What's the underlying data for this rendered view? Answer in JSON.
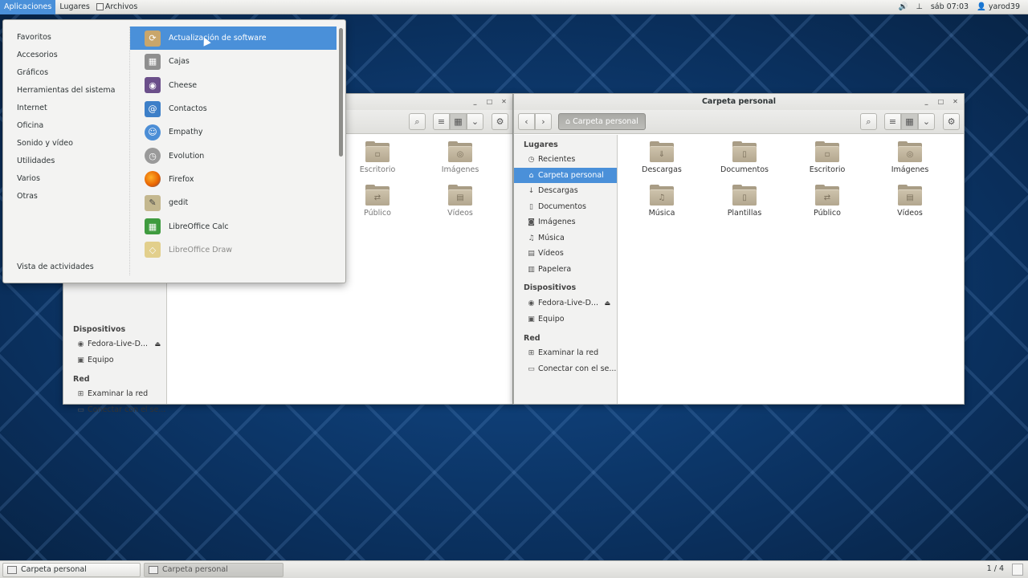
{
  "topbar": {
    "menus": [
      "Aplicaciones",
      "Lugares",
      "Archivos"
    ],
    "clock": "sáb 07:03",
    "user": "yarod39"
  },
  "appmenu": {
    "categories": [
      "Favoritos",
      "Accesorios",
      "Gráficos",
      "Herramientas del sistema",
      "Internet",
      "Oficina",
      "Sonido y vídeo",
      "Utilidades",
      "Varios",
      "Otras"
    ],
    "activities": "Vista de actividades",
    "apps": [
      {
        "label": "Actualización de software",
        "icon": "software-update-icon",
        "color": "#c9a66b"
      },
      {
        "label": "Cajas",
        "icon": "boxes-icon",
        "color": "#8f8f8f"
      },
      {
        "label": "Cheese",
        "icon": "cheese-icon",
        "color": "#6b4f8a"
      },
      {
        "label": "Contactos",
        "icon": "contacts-icon",
        "color": "#3d7fc8"
      },
      {
        "label": "Empathy",
        "icon": "empathy-icon",
        "color": "#4c8ed6"
      },
      {
        "label": "Evolution",
        "icon": "evolution-icon",
        "color": "#9a9a9a"
      },
      {
        "label": "Firefox",
        "icon": "firefox-icon",
        "color": "#e66000"
      },
      {
        "label": "gedit",
        "icon": "gedit-icon",
        "color": "#c4b88f"
      },
      {
        "label": "LibreOffice Calc",
        "icon": "libreoffice-calc-icon",
        "color": "#3f9b3f"
      },
      {
        "label": "LibreOffice Draw",
        "icon": "libreoffice-draw-icon",
        "color": "#d7b84a"
      }
    ]
  },
  "window_right": {
    "title": "Carpeta personal",
    "breadcrumb": "Carpeta personal",
    "sidebar": {
      "places_header": "Lugares",
      "places": [
        {
          "label": "Recientes",
          "icon": "clock-icon"
        },
        {
          "label": "Carpeta personal",
          "icon": "home-icon"
        },
        {
          "label": "Descargas",
          "icon": "download-icon"
        },
        {
          "label": "Documentos",
          "icon": "document-icon"
        },
        {
          "label": "Imágenes",
          "icon": "camera-icon"
        },
        {
          "label": "Música",
          "icon": "music-icon"
        },
        {
          "label": "Vídeos",
          "icon": "film-icon"
        },
        {
          "label": "Papelera",
          "icon": "trash-icon"
        }
      ],
      "devices_header": "Dispositivos",
      "devices": [
        {
          "label": "Fedora-Live-D...",
          "icon": "disc-icon"
        },
        {
          "label": "Equipo",
          "icon": "computer-icon"
        }
      ],
      "network_header": "Red",
      "network": [
        {
          "label": "Examinar la red",
          "icon": "network-icon"
        },
        {
          "label": "Conectar con el se...",
          "icon": "server-icon"
        }
      ]
    },
    "folders": [
      "Descargas",
      "Documentos",
      "Escritorio",
      "Imágenes",
      "Música",
      "Plantillas",
      "Público",
      "Vídeos"
    ]
  },
  "window_left": {
    "folders": [
      "Escritorio",
      "Imágenes",
      "Público",
      "Vídeos"
    ],
    "sidebar": {
      "devices_header": "Dispositivos",
      "devices": [
        "Fedora-Live-D...",
        "Equipo"
      ],
      "network_header": "Red",
      "network": [
        "Examinar la red",
        "Conectar con el se..."
      ]
    }
  },
  "taskbar": {
    "tasks": [
      "Carpeta personal",
      "Carpeta personal"
    ],
    "pager": "1 / 4"
  }
}
